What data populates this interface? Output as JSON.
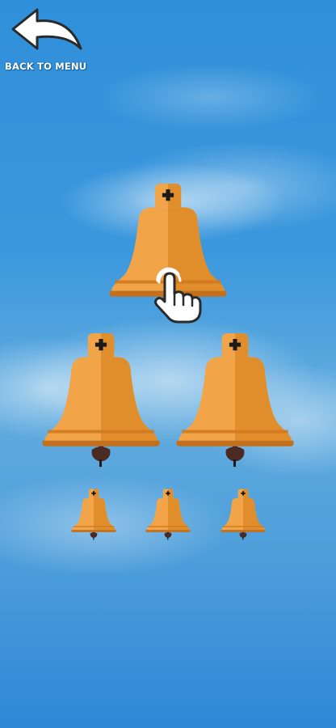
{
  "header": {
    "back_label": "BACK TO MENU",
    "back_icon": "curved-back-arrow-icon"
  },
  "game": {
    "bells": [
      {
        "name": "bell-large-top"
      },
      {
        "name": "bell-large-left"
      },
      {
        "name": "bell-large-right"
      },
      {
        "name": "bell-small-left"
      },
      {
        "name": "bell-small-center"
      },
      {
        "name": "bell-small-right"
      }
    ],
    "hint_icon": "tap-hand-icon"
  },
  "colors": {
    "sky": "#3c98dd",
    "bell_light": "#f2a548",
    "bell_dark": "#e08e2c",
    "bell_band": "#d0781e",
    "clapper": "#4a2a22"
  }
}
